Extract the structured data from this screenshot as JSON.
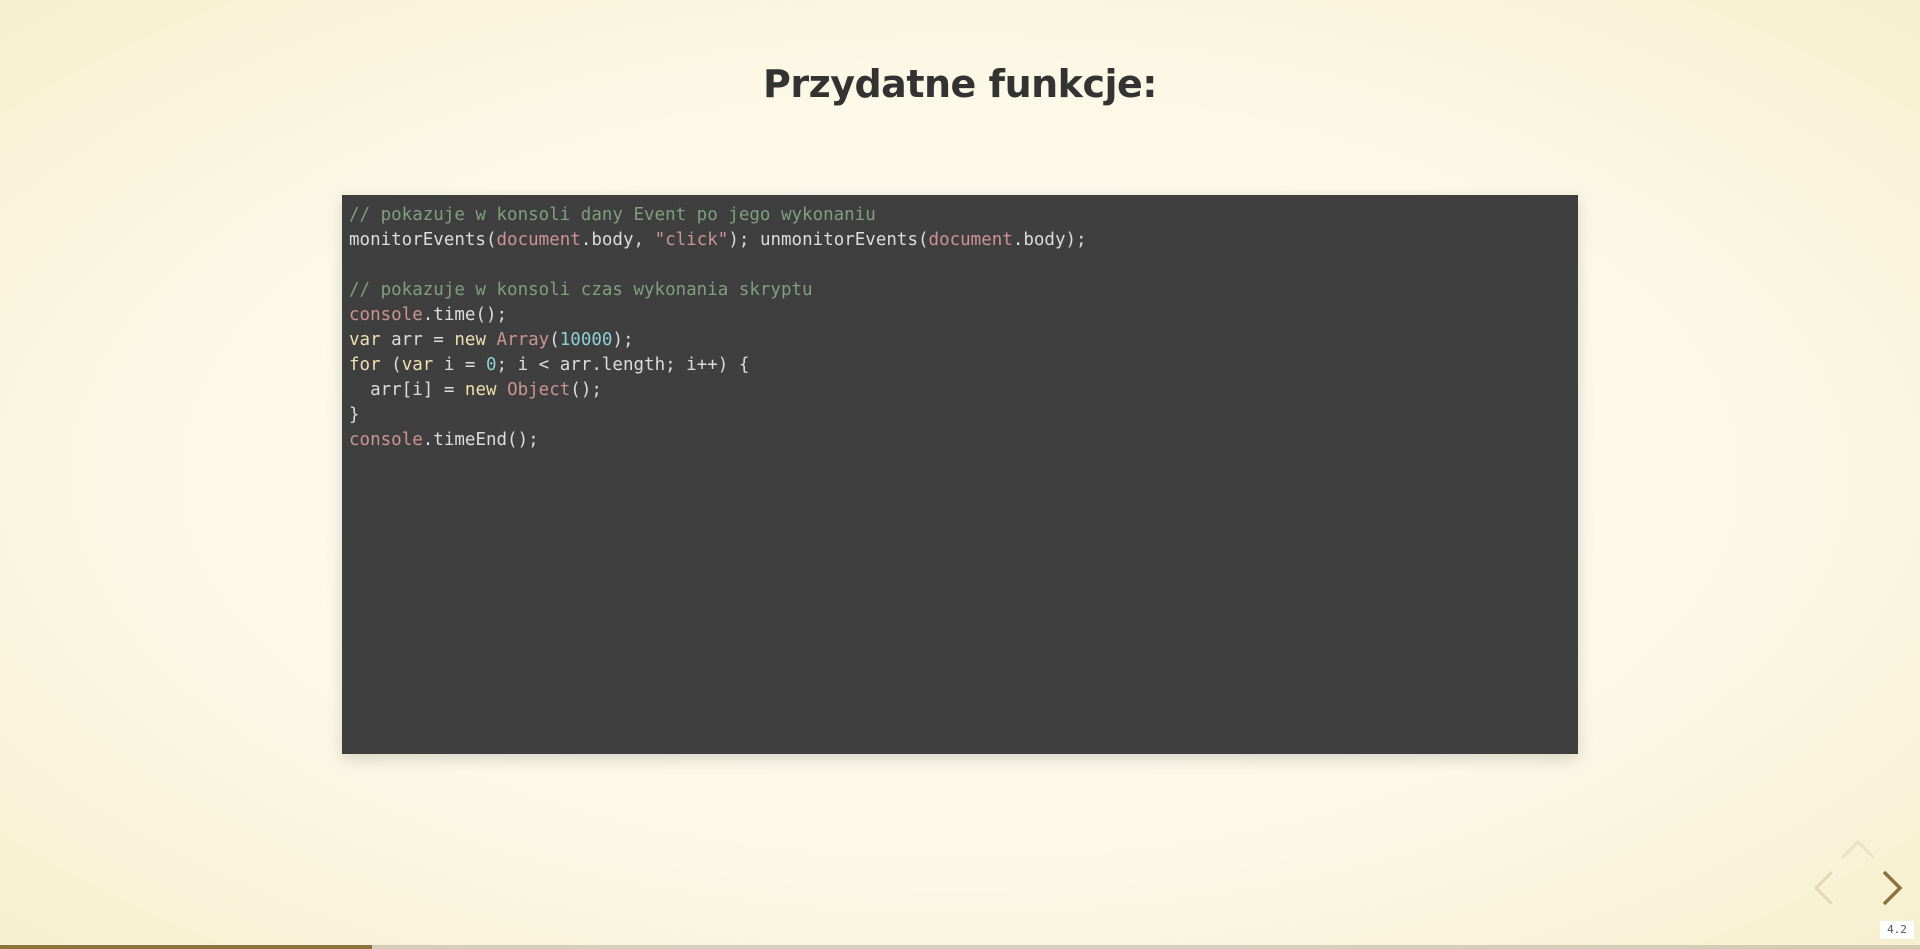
{
  "slide": {
    "title": "Przydatne funkcje:",
    "code_lines": [
      [
        {
          "t": "// pokazuje w konsoli dany Event po jego wykonaniu",
          "c": "comment"
        }
      ],
      [
        {
          "t": "monitorEvents(",
          "c": "plain"
        },
        {
          "t": "document",
          "c": "builtin"
        },
        {
          "t": ".body, ",
          "c": "plain"
        },
        {
          "t": "\"click\"",
          "c": "string"
        },
        {
          "t": "); unmonitorEvents(",
          "c": "plain"
        },
        {
          "t": "document",
          "c": "builtin"
        },
        {
          "t": ".body);",
          "c": "plain"
        }
      ],
      [],
      [
        {
          "t": "// pokazuje w konsoli czas wykonania skryptu",
          "c": "comment"
        }
      ],
      [
        {
          "t": "console",
          "c": "builtin"
        },
        {
          "t": ".time();",
          "c": "plain"
        }
      ],
      [
        {
          "t": "var",
          "c": "keyword"
        },
        {
          "t": " arr = ",
          "c": "plain"
        },
        {
          "t": "new",
          "c": "keyword"
        },
        {
          "t": " ",
          "c": "plain"
        },
        {
          "t": "Array",
          "c": "builtin"
        },
        {
          "t": "(",
          "c": "plain"
        },
        {
          "t": "10000",
          "c": "number"
        },
        {
          "t": ");",
          "c": "plain"
        }
      ],
      [
        {
          "t": "for",
          "c": "keyword"
        },
        {
          "t": " (",
          "c": "plain"
        },
        {
          "t": "var",
          "c": "keyword"
        },
        {
          "t": " i = ",
          "c": "plain"
        },
        {
          "t": "0",
          "c": "number"
        },
        {
          "t": "; i < arr.length; i++) {",
          "c": "plain"
        }
      ],
      [
        {
          "t": "  arr[i] = ",
          "c": "plain"
        },
        {
          "t": "new",
          "c": "keyword"
        },
        {
          "t": " ",
          "c": "plain"
        },
        {
          "t": "Object",
          "c": "builtin"
        },
        {
          "t": "();",
          "c": "plain"
        }
      ],
      [
        {
          "t": "}",
          "c": "plain"
        }
      ],
      [
        {
          "t": "console",
          "c": "builtin"
        },
        {
          "t": ".timeEnd();",
          "c": "plain"
        }
      ]
    ]
  },
  "navigation": {
    "left_icon": "chevron-left-icon",
    "right_icon": "chevron-right-icon",
    "up_icon": "chevron-up-icon",
    "slide_number": "4.2",
    "progress": 0.194
  },
  "colors": {
    "code_background": "#3f3f3f",
    "comment": "#7f9f7f",
    "keyword": "#f0dfaf",
    "builtin": "#cc9393",
    "number": "#8cd0d3",
    "accent": "#8b743d"
  }
}
